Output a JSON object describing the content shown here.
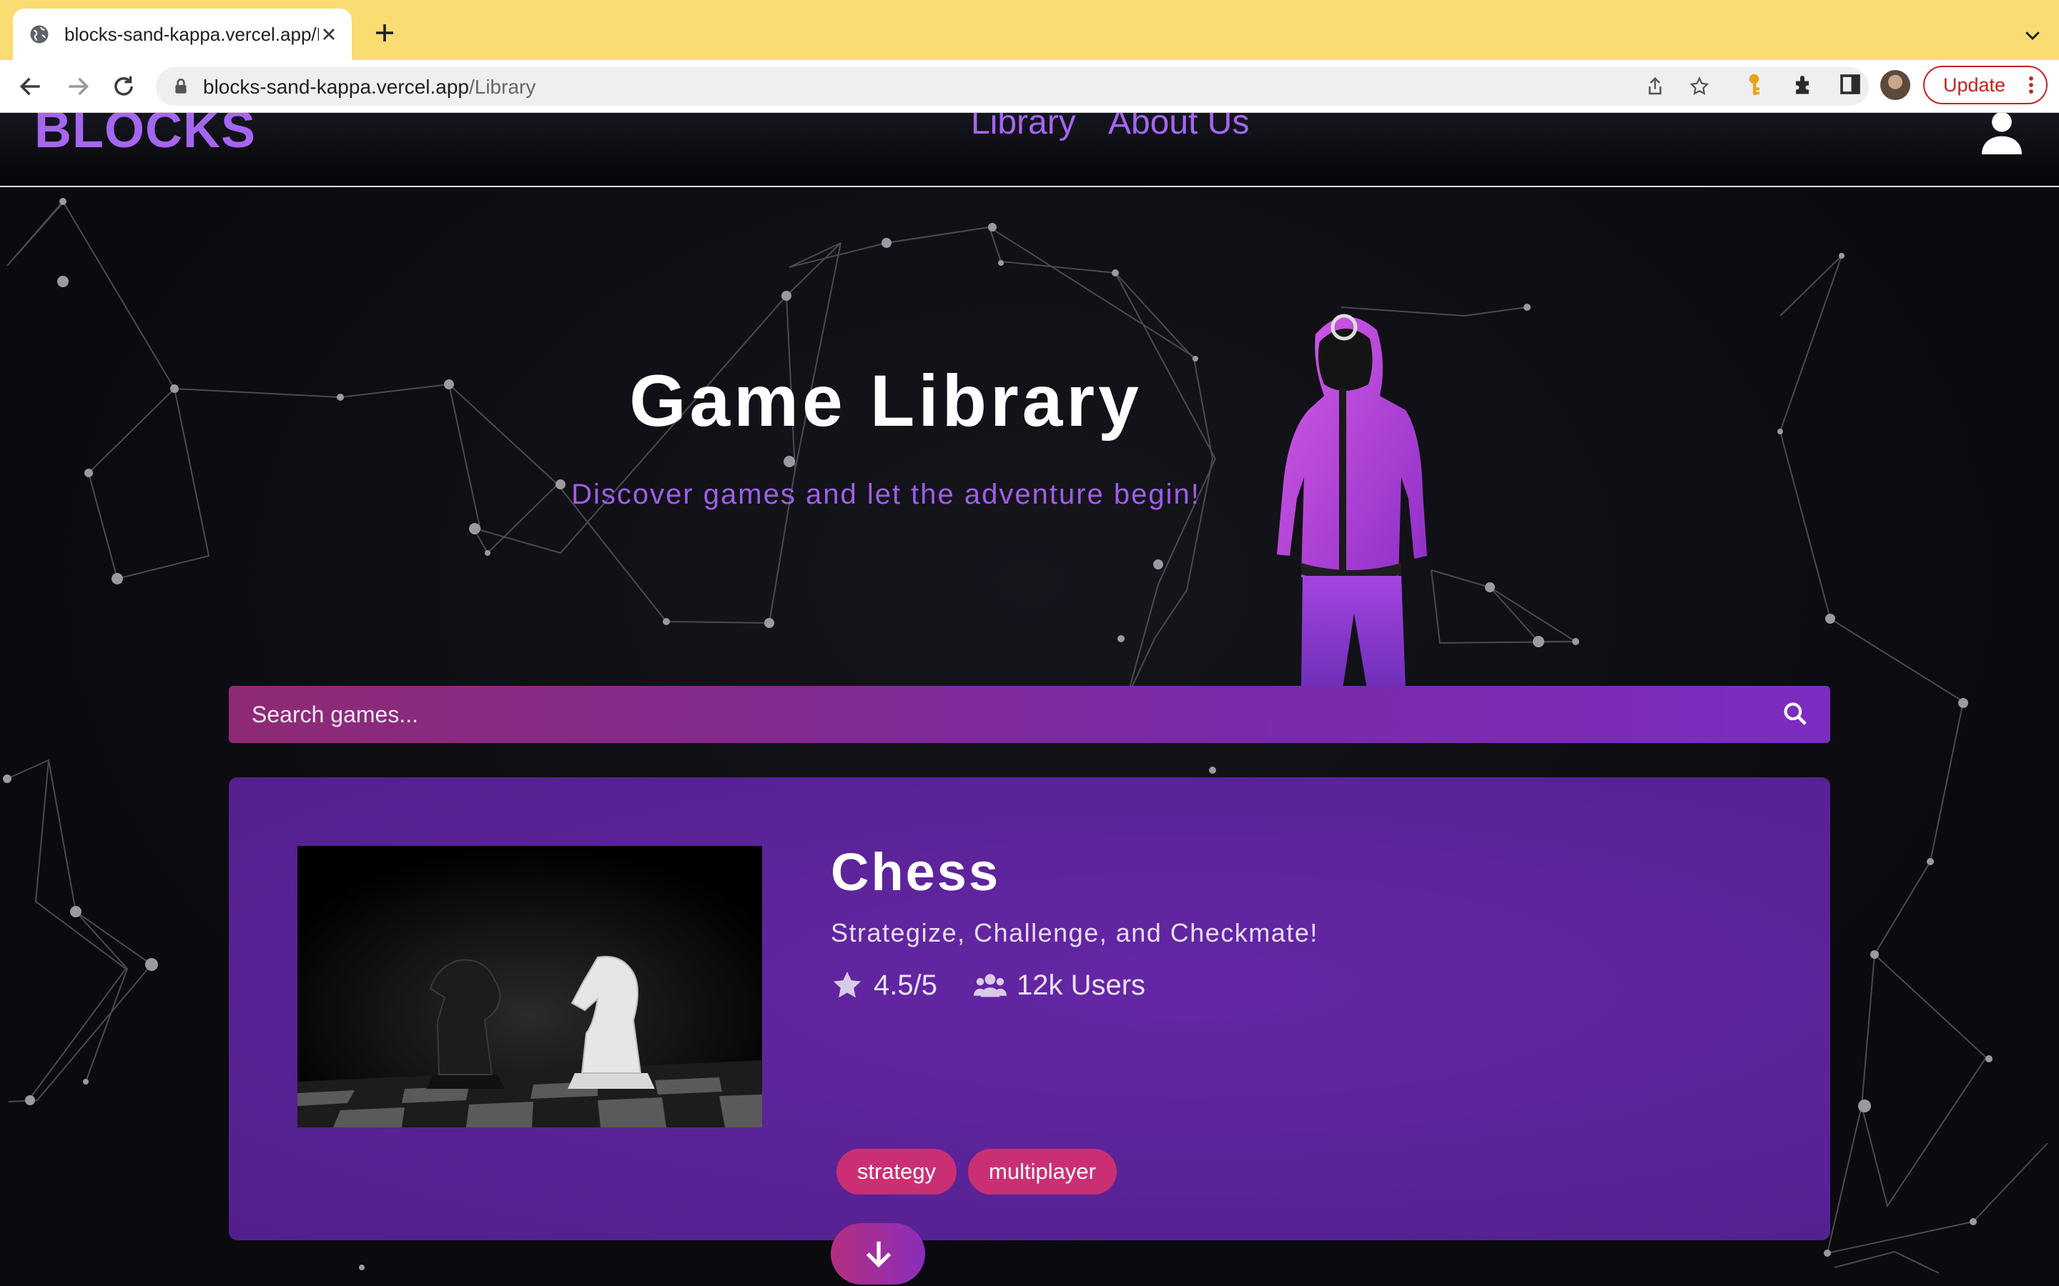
{
  "browser": {
    "tab_title": "blocks-sand-kappa.vercel.app/Library",
    "url_host": "blocks-sand-kappa.vercel.app",
    "url_path": "/Library",
    "update_label": "Update",
    "accent_color": "#fbdc73"
  },
  "site": {
    "logo": "BLOCKS",
    "nav": [
      {
        "label": "Library"
      },
      {
        "label": "About Us"
      }
    ],
    "brand_color": "#a566f0"
  },
  "hero": {
    "title": "Game Library",
    "subtitle": "Discover games and let the adventure begin!"
  },
  "search": {
    "placeholder": "Search games...",
    "value": ""
  },
  "games": [
    {
      "title": "Chess",
      "tagline": "Strategize, Challenge, and Checkmate!",
      "rating": "4.5/5",
      "users": "12k Users",
      "tags": [
        "strategy",
        "multiplayer"
      ],
      "icons": {
        "rating": "star-icon",
        "users": "users-icon",
        "download": "download-arrow-icon"
      }
    }
  ]
}
